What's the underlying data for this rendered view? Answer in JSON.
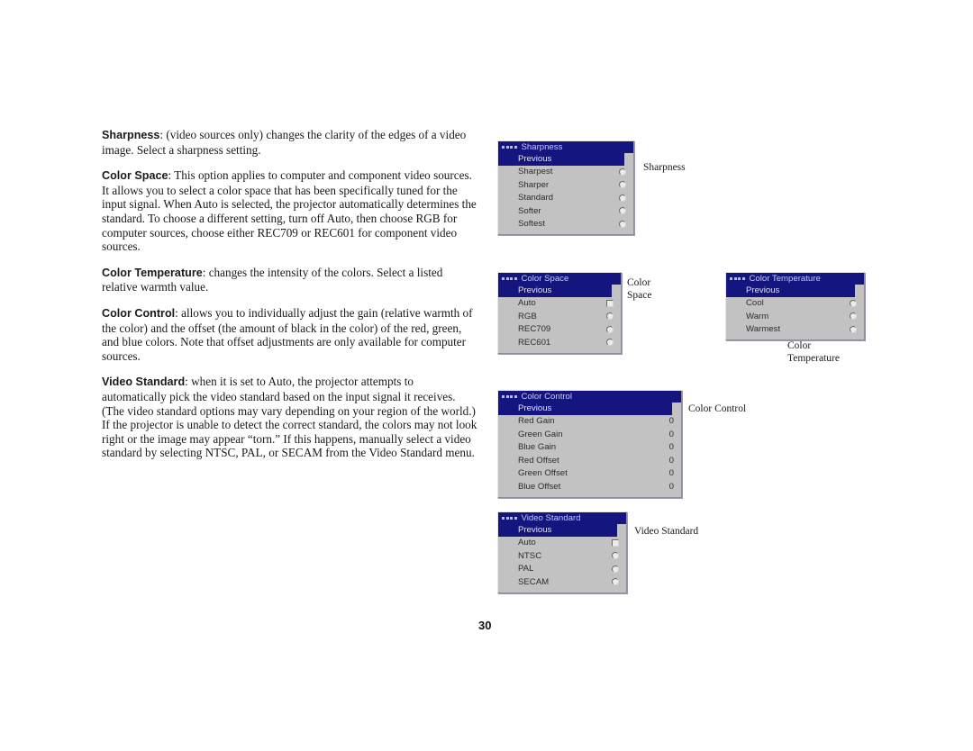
{
  "document": {
    "page_number": "30",
    "paragraphs": [
      {
        "lead": "Sharpness",
        "text": ": (video sources only) changes the clarity of the edges of a video image. Select a sharpness setting."
      },
      {
        "lead": "Color Space",
        "text": ": This option applies to computer and component video sources. It allows you to select a color space that has been specifically tuned for the input signal. When Auto is selected, the projector automatically determines the standard. To choose a different setting, turn off Auto, then choose RGB for computer sources, choose either REC709 or REC601 for component video sources."
      },
      {
        "lead": "Color Temperature",
        "text": ": changes the intensity of the colors. Select a listed relative warmth value."
      },
      {
        "lead": "Color Control",
        "text": ": allows you to individually adjust the gain (relative warmth of the color) and the offset (the amount of black in the color) of the red, green, and blue colors. Note that offset adjustments are only available for computer sources."
      },
      {
        "lead": "Video Standard",
        "text": ": when it is set to Auto, the projector attempts to automatically pick the video standard based on the input signal it receives. (The video standard options may vary depending on your region of the world.) If the projector is unable to detect the correct standard, the colors may not look right or the image may appear “torn.” If this happens, manually select a video standard by selecting NTSC, PAL, or SECAM from the Video Standard menu."
      }
    ]
  },
  "colors": {
    "menu_title_bar": "#151580",
    "menu_background": "#c2c2c2",
    "menu_highlight": "#151580",
    "menu_title_text": "#c9c9e8",
    "page_background": "#ffffff"
  },
  "menus": {
    "sharpness": {
      "title": "Sharpness",
      "previous_label": "Previous",
      "callout": "Sharpness",
      "rows": [
        {
          "label": "Sharpest",
          "control": "radio"
        },
        {
          "label": "Sharper",
          "control": "radio"
        },
        {
          "label": "Standard",
          "control": "radio"
        },
        {
          "label": "Softer",
          "control": "radio"
        },
        {
          "label": "Softest",
          "control": "radio"
        }
      ]
    },
    "color_space": {
      "title": "Color Space",
      "previous_label": "Previous",
      "callout": "Color\nSpace",
      "rows": [
        {
          "label": "Auto",
          "control": "checkbox"
        },
        {
          "label": "RGB",
          "control": "radio"
        },
        {
          "label": "REC709",
          "control": "radio"
        },
        {
          "label": "REC601",
          "control": "radio"
        }
      ]
    },
    "color_temperature": {
      "title": "Color Temperature",
      "previous_label": "Previous",
      "callout": "Color\nTemperature",
      "rows": [
        {
          "label": "Cool",
          "control": "radio"
        },
        {
          "label": "Warm",
          "control": "radio"
        },
        {
          "label": "Warmest",
          "control": "radio"
        }
      ]
    },
    "color_control": {
      "title": "Color Control",
      "previous_label": "Previous",
      "callout": "Color Control",
      "rows": [
        {
          "label": "Red Gain",
          "value": "0"
        },
        {
          "label": "Green Gain",
          "value": "0"
        },
        {
          "label": "Blue Gain",
          "value": "0"
        },
        {
          "label": "Red Offset",
          "value": "0"
        },
        {
          "label": "Green Offset",
          "value": "0"
        },
        {
          "label": "Blue Offset",
          "value": "0"
        }
      ]
    },
    "video_standard": {
      "title": "Video Standard",
      "previous_label": "Previous",
      "callout": "Video Standard",
      "rows": [
        {
          "label": "Auto",
          "control": "checkbox"
        },
        {
          "label": "NTSC",
          "control": "radio"
        },
        {
          "label": "PAL",
          "control": "radio"
        },
        {
          "label": "SECAM",
          "control": "radio"
        }
      ]
    }
  }
}
